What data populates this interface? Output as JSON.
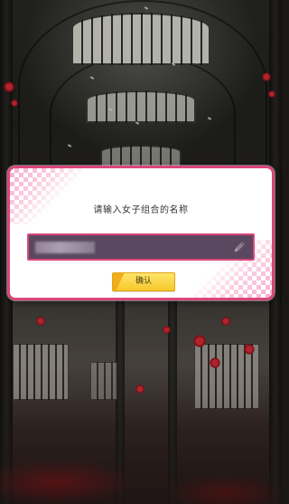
{
  "dialog": {
    "title": "请输入女子组合的名称",
    "confirm_label": "确认"
  },
  "input": {
    "value": "",
    "placeholder": "",
    "icon": "pencil-icon"
  },
  "colors": {
    "dialog_border": "#d9467a",
    "input_background": "#5a4860",
    "button_fill": "#f7c92b",
    "decor_pink": "#f6a6c6"
  }
}
